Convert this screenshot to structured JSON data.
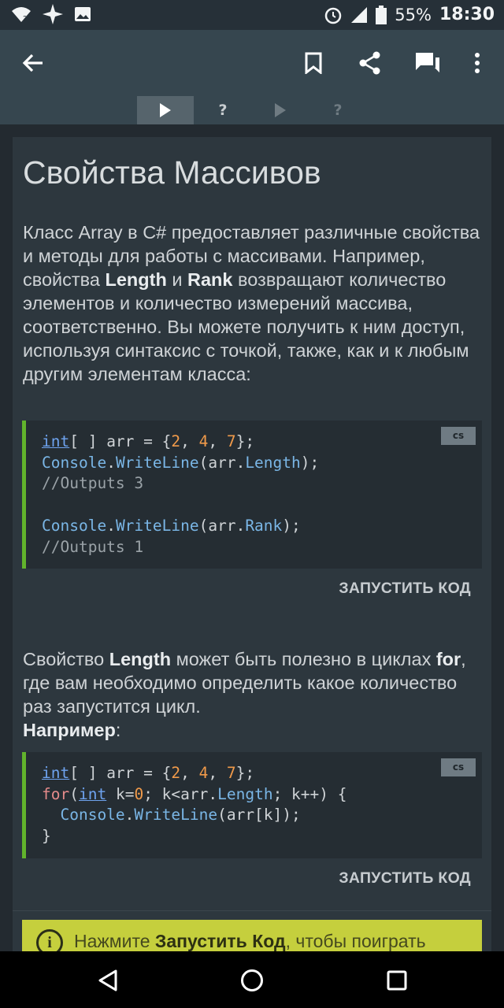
{
  "status_bar": {
    "battery": "55%",
    "time": "18:30",
    "icons": [
      "wifi-icon",
      "sparkle-icon",
      "image-icon",
      "alarm-icon",
      "signal-icon",
      "battery-icon"
    ]
  },
  "app_bar": {
    "icons": [
      "back-arrow-icon",
      "bookmark-icon",
      "share-icon",
      "comments-icon",
      "more-vert-icon"
    ]
  },
  "tabs": [
    {
      "label": "",
      "icon": "play-icon",
      "state": "active"
    },
    {
      "label": "?",
      "state": "normal"
    },
    {
      "label": "",
      "icon": "play-icon",
      "state": "disabled"
    },
    {
      "label": "?",
      "state": "disabled"
    }
  ],
  "lesson": {
    "title": "Свойства Массивов",
    "p1": {
      "a": "Класс Array в C# предоставляет различные свойства и методы для работы с массивами. Например, свойства ",
      "b1": "Length",
      "c": " и ",
      "b2": "Rank",
      "d": " возвращают количество элементов и количество измерений массива, соответственно. Вы можете получить к ним доступ, используя синтаксис с точкой, также, как и к любым другим элементам класса:"
    },
    "code1_badge": "cs",
    "run_label": "ЗАПУСТИТЬ КОД",
    "p2": {
      "a": "Свойство ",
      "b1": "Length",
      "c": " может быть полезно в циклах ",
      "b2": "for",
      "d": ", где вам необходимо определить какое количество раз запустится цикл.",
      "b3": "Например",
      "e": ":"
    },
    "code2_badge": "cs",
    "tip": {
      "a": "Нажмите ",
      "b": "Запустить Код",
      "c": ", чтобы поиграть"
    }
  },
  "colors": {
    "accent_green": "#62b32c",
    "tip_yellow": "#c5cf3d",
    "keyword_blue": "#6ea3ef",
    "number_orange": "#f09a4a"
  },
  "nav_bar": {
    "icons": [
      "back-triangle-icon",
      "home-circle-icon",
      "recents-square-icon"
    ]
  }
}
